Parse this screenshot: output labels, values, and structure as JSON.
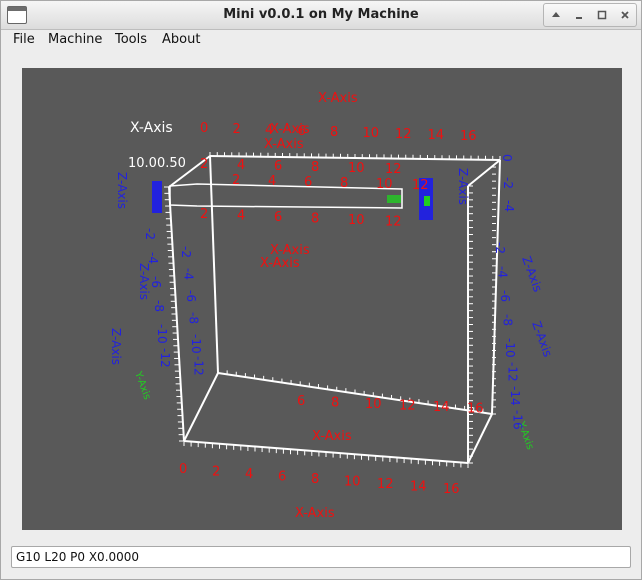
{
  "window": {
    "title": "Mini v0.0.1 on My Machine",
    "controls": {
      "up_icon": "arrow-up-icon",
      "minimize_icon": "minimize-icon",
      "maximize_icon": "maximize-icon",
      "close_icon": "close-icon"
    }
  },
  "menu": [
    "File",
    "Machine",
    "Tools",
    "About"
  ],
  "viewport": {
    "background": "#595959",
    "colors": {
      "x_axis": "#ee1111",
      "z_axis": "#2222dd",
      "y_axis": "#22cc22",
      "box": "#ffffff"
    },
    "labels": {
      "x_axis": "X-Axis",
      "y_axis": "Y-Axis",
      "z_axis": "Z-Axis",
      "overlap_text": "10.00.50",
      "x_top_ticks": [
        "0",
        "2",
        "4",
        "6",
        "8",
        "10",
        "12",
        "14",
        "16"
      ],
      "x_bottom_ticks": [
        "0",
        "2",
        "4",
        "6",
        "8",
        "10",
        "12",
        "14",
        "16"
      ],
      "x_mid_ticks": [
        "6",
        "8",
        "10",
        "12",
        "14",
        "16"
      ],
      "x_front_ticks": [
        "2",
        "4",
        "6",
        "8",
        "10",
        "12"
      ],
      "z_left_ticks": [
        "-2",
        "-4",
        "-6",
        "-8",
        "-10",
        "-12"
      ],
      "z_right_ticks": [
        "-2",
        "-4",
        "-6",
        "-8",
        "-10",
        "-12",
        "-14",
        "-16"
      ],
      "z_top_ticks": [
        "0",
        "-2",
        "-4"
      ]
    }
  },
  "command_input": {
    "value": "G10 L20 P0 X0.0000"
  }
}
